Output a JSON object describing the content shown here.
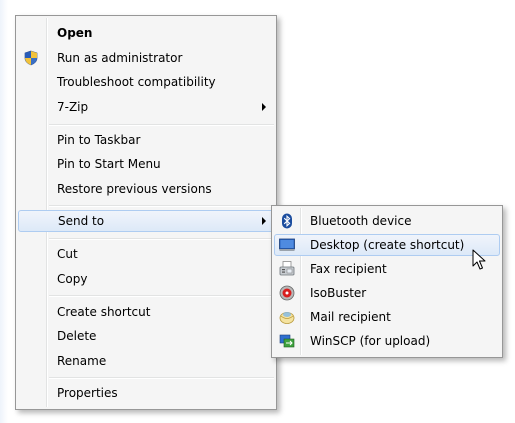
{
  "main_menu": {
    "items": [
      {
        "label": "Open"
      },
      {
        "label": "Run as administrator",
        "icon": "uac-shield-icon"
      },
      {
        "label": "Troubleshoot compatibility"
      },
      {
        "label": "7-Zip"
      },
      {
        "label": "Pin to Taskbar"
      },
      {
        "label": "Pin to Start Menu"
      },
      {
        "label": "Restore previous versions"
      },
      {
        "label": "Send to"
      },
      {
        "label": "Cut"
      },
      {
        "label": "Copy"
      },
      {
        "label": "Create shortcut"
      },
      {
        "label": "Delete"
      },
      {
        "label": "Rename"
      },
      {
        "label": "Properties"
      }
    ]
  },
  "send_to_menu": {
    "items": [
      {
        "label": "Bluetooth device",
        "icon": "bluetooth-icon"
      },
      {
        "label": "Desktop (create shortcut)",
        "icon": "desktop-icon"
      },
      {
        "label": "Fax recipient",
        "icon": "fax-icon"
      },
      {
        "label": "IsoBuster",
        "icon": "isobuster-icon"
      },
      {
        "label": "Mail recipient",
        "icon": "mail-icon"
      },
      {
        "label": "WinSCP (for upload)",
        "icon": "winscp-icon"
      }
    ]
  },
  "colors": {
    "menu_background": "#f5f5f5",
    "menu_border": "#979797",
    "highlight_border": "#aeccf1",
    "highlight_fill": "#dde9f8"
  }
}
